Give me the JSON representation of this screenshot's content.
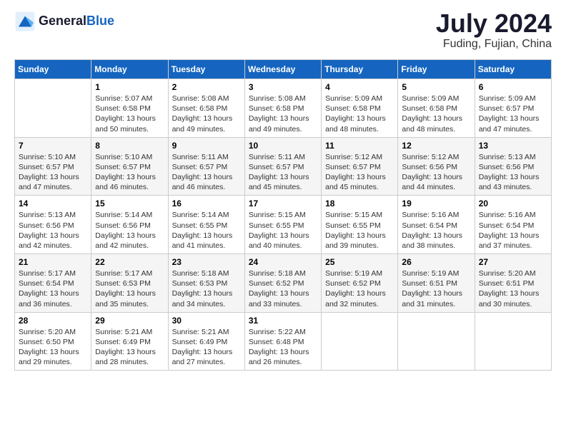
{
  "app": {
    "name": "GeneralBlue",
    "logo_text_line1": "General",
    "logo_text_line2": "Blue"
  },
  "calendar": {
    "month_year": "July 2024",
    "location": "Fuding, Fujian, China",
    "days_of_week": [
      "Sunday",
      "Monday",
      "Tuesday",
      "Wednesday",
      "Thursday",
      "Friday",
      "Saturday"
    ],
    "weeks": [
      [
        {
          "day": "",
          "text": ""
        },
        {
          "day": "1",
          "text": "Sunrise: 5:07 AM\nSunset: 6:58 PM\nDaylight: 13 hours\nand 50 minutes."
        },
        {
          "day": "2",
          "text": "Sunrise: 5:08 AM\nSunset: 6:58 PM\nDaylight: 13 hours\nand 49 minutes."
        },
        {
          "day": "3",
          "text": "Sunrise: 5:08 AM\nSunset: 6:58 PM\nDaylight: 13 hours\nand 49 minutes."
        },
        {
          "day": "4",
          "text": "Sunrise: 5:09 AM\nSunset: 6:58 PM\nDaylight: 13 hours\nand 48 minutes."
        },
        {
          "day": "5",
          "text": "Sunrise: 5:09 AM\nSunset: 6:58 PM\nDaylight: 13 hours\nand 48 minutes."
        },
        {
          "day": "6",
          "text": "Sunrise: 5:09 AM\nSunset: 6:57 PM\nDaylight: 13 hours\nand 47 minutes."
        }
      ],
      [
        {
          "day": "7",
          "text": "Sunrise: 5:10 AM\nSunset: 6:57 PM\nDaylight: 13 hours\nand 47 minutes."
        },
        {
          "day": "8",
          "text": "Sunrise: 5:10 AM\nSunset: 6:57 PM\nDaylight: 13 hours\nand 46 minutes."
        },
        {
          "day": "9",
          "text": "Sunrise: 5:11 AM\nSunset: 6:57 PM\nDaylight: 13 hours\nand 46 minutes."
        },
        {
          "day": "10",
          "text": "Sunrise: 5:11 AM\nSunset: 6:57 PM\nDaylight: 13 hours\nand 45 minutes."
        },
        {
          "day": "11",
          "text": "Sunrise: 5:12 AM\nSunset: 6:57 PM\nDaylight: 13 hours\nand 45 minutes."
        },
        {
          "day": "12",
          "text": "Sunrise: 5:12 AM\nSunset: 6:56 PM\nDaylight: 13 hours\nand 44 minutes."
        },
        {
          "day": "13",
          "text": "Sunrise: 5:13 AM\nSunset: 6:56 PM\nDaylight: 13 hours\nand 43 minutes."
        }
      ],
      [
        {
          "day": "14",
          "text": "Sunrise: 5:13 AM\nSunset: 6:56 PM\nDaylight: 13 hours\nand 42 minutes."
        },
        {
          "day": "15",
          "text": "Sunrise: 5:14 AM\nSunset: 6:56 PM\nDaylight: 13 hours\nand 42 minutes."
        },
        {
          "day": "16",
          "text": "Sunrise: 5:14 AM\nSunset: 6:55 PM\nDaylight: 13 hours\nand 41 minutes."
        },
        {
          "day": "17",
          "text": "Sunrise: 5:15 AM\nSunset: 6:55 PM\nDaylight: 13 hours\nand 40 minutes."
        },
        {
          "day": "18",
          "text": "Sunrise: 5:15 AM\nSunset: 6:55 PM\nDaylight: 13 hours\nand 39 minutes."
        },
        {
          "day": "19",
          "text": "Sunrise: 5:16 AM\nSunset: 6:54 PM\nDaylight: 13 hours\nand 38 minutes."
        },
        {
          "day": "20",
          "text": "Sunrise: 5:16 AM\nSunset: 6:54 PM\nDaylight: 13 hours\nand 37 minutes."
        }
      ],
      [
        {
          "day": "21",
          "text": "Sunrise: 5:17 AM\nSunset: 6:54 PM\nDaylight: 13 hours\nand 36 minutes."
        },
        {
          "day": "22",
          "text": "Sunrise: 5:17 AM\nSunset: 6:53 PM\nDaylight: 13 hours\nand 35 minutes."
        },
        {
          "day": "23",
          "text": "Sunrise: 5:18 AM\nSunset: 6:53 PM\nDaylight: 13 hours\nand 34 minutes."
        },
        {
          "day": "24",
          "text": "Sunrise: 5:18 AM\nSunset: 6:52 PM\nDaylight: 13 hours\nand 33 minutes."
        },
        {
          "day": "25",
          "text": "Sunrise: 5:19 AM\nSunset: 6:52 PM\nDaylight: 13 hours\nand 32 minutes."
        },
        {
          "day": "26",
          "text": "Sunrise: 5:19 AM\nSunset: 6:51 PM\nDaylight: 13 hours\nand 31 minutes."
        },
        {
          "day": "27",
          "text": "Sunrise: 5:20 AM\nSunset: 6:51 PM\nDaylight: 13 hours\nand 30 minutes."
        }
      ],
      [
        {
          "day": "28",
          "text": "Sunrise: 5:20 AM\nSunset: 6:50 PM\nDaylight: 13 hours\nand 29 minutes."
        },
        {
          "day": "29",
          "text": "Sunrise: 5:21 AM\nSunset: 6:49 PM\nDaylight: 13 hours\nand 28 minutes."
        },
        {
          "day": "30",
          "text": "Sunrise: 5:21 AM\nSunset: 6:49 PM\nDaylight: 13 hours\nand 27 minutes."
        },
        {
          "day": "31",
          "text": "Sunrise: 5:22 AM\nSunset: 6:48 PM\nDaylight: 13 hours\nand 26 minutes."
        },
        {
          "day": "",
          "text": ""
        },
        {
          "day": "",
          "text": ""
        },
        {
          "day": "",
          "text": ""
        }
      ]
    ]
  }
}
